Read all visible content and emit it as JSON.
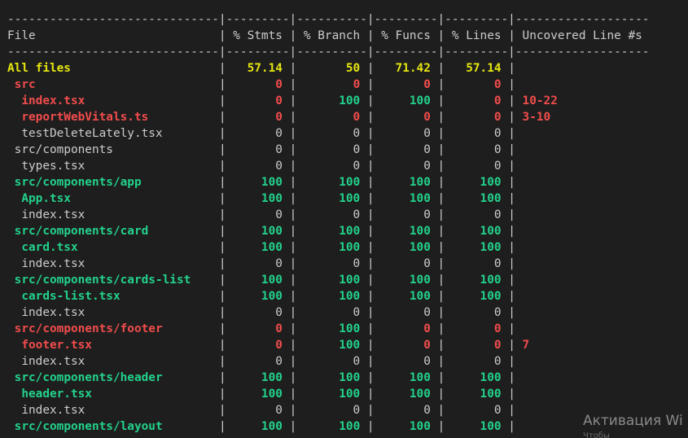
{
  "colors": {
    "background": "#1e1e1e",
    "default": "#cccccc",
    "yellow": "#e5e510",
    "red": "#f14c4c",
    "green": "#23d18b"
  },
  "coverage": {
    "columns": [
      "File",
      "% Stmts",
      "% Branch",
      "% Funcs",
      "% Lines",
      "Uncovered Line #s"
    ],
    "rows": [
      {
        "file": "All files",
        "indent": 0,
        "stmts": "57.14",
        "branch": "50",
        "funcs": "71.42",
        "lines": "57.14",
        "uncovered": "",
        "color": "yellow",
        "bold": true
      },
      {
        "file": "src",
        "indent": 1,
        "stmts": "0",
        "branch": "0",
        "funcs": "0",
        "lines": "0",
        "uncovered": "",
        "color": "red",
        "bold": true
      },
      {
        "file": "index.tsx",
        "indent": 2,
        "stmts": "0",
        "branch": "100",
        "funcs": "100",
        "lines": "0",
        "uncovered": "10-22",
        "color": "red",
        "bold": true,
        "colors": {
          "stmts": "red",
          "branch": "green",
          "funcs": "green",
          "lines": "red",
          "uncovered": "red"
        }
      },
      {
        "file": "reportWebVitals.ts",
        "indent": 2,
        "stmts": "0",
        "branch": "0",
        "funcs": "0",
        "lines": "0",
        "uncovered": "3-10",
        "color": "red",
        "bold": true
      },
      {
        "file": "testDeleteLately.tsx",
        "indent": 2,
        "stmts": "0",
        "branch": "0",
        "funcs": "0",
        "lines": "0",
        "uncovered": "",
        "color": "default",
        "bold": false
      },
      {
        "file": "src/components",
        "indent": 1,
        "stmts": "0",
        "branch": "0",
        "funcs": "0",
        "lines": "0",
        "uncovered": "",
        "color": "default",
        "bold": false
      },
      {
        "file": "types.tsx",
        "indent": 2,
        "stmts": "0",
        "branch": "0",
        "funcs": "0",
        "lines": "0",
        "uncovered": "",
        "color": "default",
        "bold": false
      },
      {
        "file": "src/components/app",
        "indent": 1,
        "stmts": "100",
        "branch": "100",
        "funcs": "100",
        "lines": "100",
        "uncovered": "",
        "color": "green",
        "bold": true
      },
      {
        "file": "App.tsx",
        "indent": 2,
        "stmts": "100",
        "branch": "100",
        "funcs": "100",
        "lines": "100",
        "uncovered": "",
        "color": "green",
        "bold": true
      },
      {
        "file": "index.tsx",
        "indent": 2,
        "stmts": "0",
        "branch": "0",
        "funcs": "0",
        "lines": "0",
        "uncovered": "",
        "color": "default",
        "bold": false
      },
      {
        "file": "src/components/card",
        "indent": 1,
        "stmts": "100",
        "branch": "100",
        "funcs": "100",
        "lines": "100",
        "uncovered": "",
        "color": "green",
        "bold": true
      },
      {
        "file": "card.tsx",
        "indent": 2,
        "stmts": "100",
        "branch": "100",
        "funcs": "100",
        "lines": "100",
        "uncovered": "",
        "color": "green",
        "bold": true
      },
      {
        "file": "index.tsx",
        "indent": 2,
        "stmts": "0",
        "branch": "0",
        "funcs": "0",
        "lines": "0",
        "uncovered": "",
        "color": "default",
        "bold": false
      },
      {
        "file": "src/components/cards-list",
        "indent": 1,
        "stmts": "100",
        "branch": "100",
        "funcs": "100",
        "lines": "100",
        "uncovered": "",
        "color": "green",
        "bold": true
      },
      {
        "file": "cards-list.tsx",
        "indent": 2,
        "stmts": "100",
        "branch": "100",
        "funcs": "100",
        "lines": "100",
        "uncovered": "",
        "color": "green",
        "bold": true
      },
      {
        "file": "index.tsx",
        "indent": 2,
        "stmts": "0",
        "branch": "0",
        "funcs": "0",
        "lines": "0",
        "uncovered": "",
        "color": "default",
        "bold": false
      },
      {
        "file": "src/components/footer",
        "indent": 1,
        "stmts": "0",
        "branch": "100",
        "funcs": "0",
        "lines": "0",
        "uncovered": "",
        "color": "red",
        "bold": true,
        "colors": {
          "stmts": "red",
          "branch": "green",
          "funcs": "red",
          "lines": "red",
          "uncovered": "red"
        }
      },
      {
        "file": "footer.tsx",
        "indent": 2,
        "stmts": "0",
        "branch": "100",
        "funcs": "0",
        "lines": "0",
        "uncovered": "7",
        "color": "red",
        "bold": true,
        "colors": {
          "stmts": "red",
          "branch": "green",
          "funcs": "red",
          "lines": "red",
          "uncovered": "red"
        }
      },
      {
        "file": "index.tsx",
        "indent": 2,
        "stmts": "0",
        "branch": "0",
        "funcs": "0",
        "lines": "0",
        "uncovered": "",
        "color": "default",
        "bold": false
      },
      {
        "file": "src/components/header",
        "indent": 1,
        "stmts": "100",
        "branch": "100",
        "funcs": "100",
        "lines": "100",
        "uncovered": "",
        "color": "green",
        "bold": true
      },
      {
        "file": "header.tsx",
        "indent": 2,
        "stmts": "100",
        "branch": "100",
        "funcs": "100",
        "lines": "100",
        "uncovered": "",
        "color": "green",
        "bold": true
      },
      {
        "file": "index.tsx",
        "indent": 2,
        "stmts": "0",
        "branch": "0",
        "funcs": "0",
        "lines": "0",
        "uncovered": "",
        "color": "default",
        "bold": false
      },
      {
        "file": "src/components/layout",
        "indent": 1,
        "stmts": "100",
        "branch": "100",
        "funcs": "100",
        "lines": "100",
        "uncovered": "",
        "color": "green",
        "bold": true
      }
    ]
  },
  "watermark": {
    "title": "Активация Wi",
    "subtitle": "Чтобы"
  }
}
